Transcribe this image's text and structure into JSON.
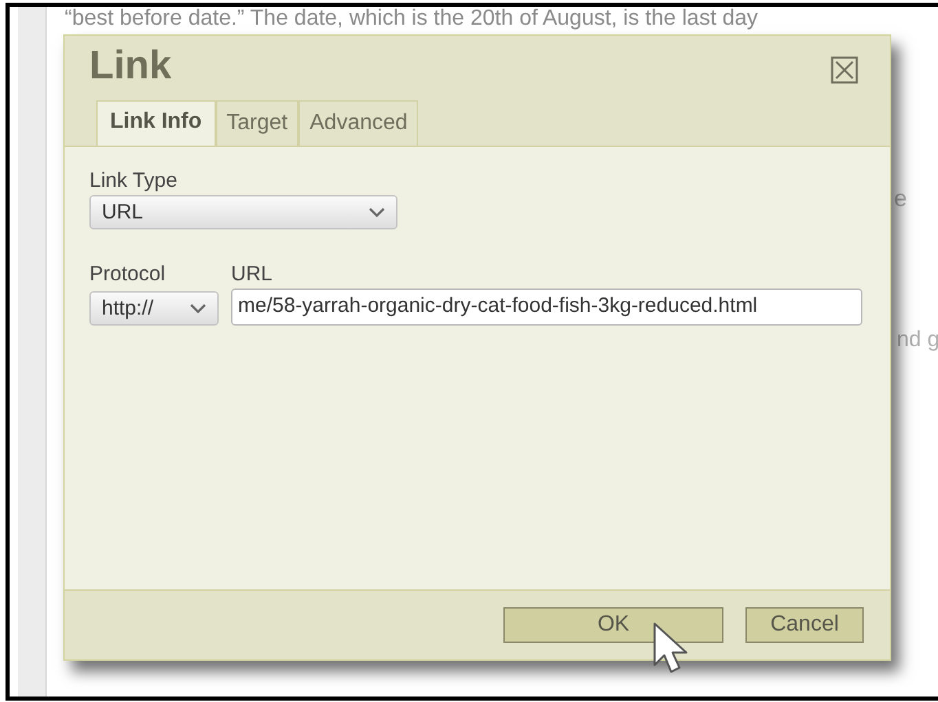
{
  "page_text": [
    {
      "text": "“best before date.” The date, which is the 20th of August, is the last day",
      "kind": "line"
    },
    {
      "text": "e",
      "kind": "fragment_upper"
    },
    {
      "text": "nd g",
      "kind": "fragment_lower"
    }
  ],
  "dialog": {
    "title": "Link",
    "tabs": [
      {
        "label": "Link Info",
        "selected": true
      },
      {
        "label": "Target",
        "selected": false
      },
      {
        "label": "Advanced",
        "selected": false
      }
    ],
    "link_type": {
      "label": "Link Type",
      "value": "URL"
    },
    "protocol": {
      "label": "Protocol",
      "value": "http://"
    },
    "url": {
      "label": "URL",
      "value": "me/58-yarrah-organic-dry-cat-food-fish-3kg-reduced.html"
    },
    "buttons": [
      {
        "label": "OK",
        "kind": "primary"
      },
      {
        "label": "Cancel",
        "kind": "secondary"
      }
    ]
  }
}
